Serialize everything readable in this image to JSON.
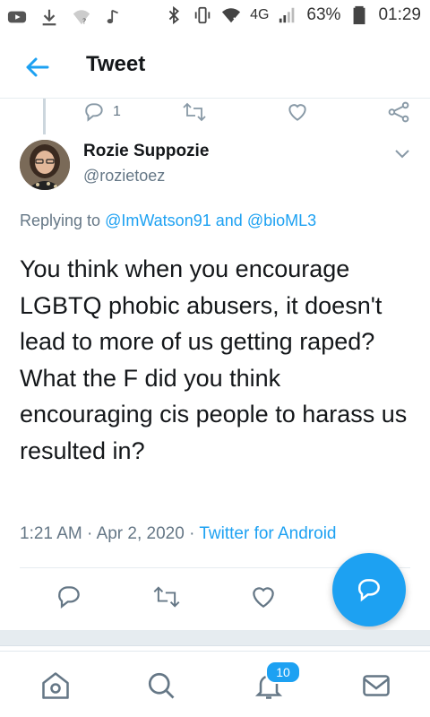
{
  "status_bar": {
    "network": "4G",
    "battery": "63%",
    "time": "01:29",
    "icons": [
      "youtube-icon",
      "download-icon",
      "wifi-question-icon",
      "music-note-icon",
      "bluetooth-icon",
      "vibrate-icon",
      "wifi-icon",
      "signal-icon",
      "battery-icon"
    ]
  },
  "app_bar": {
    "title": "Tweet",
    "back_icon": "arrow-left-icon"
  },
  "prev_tweet_actions": {
    "reply_count": "1"
  },
  "tweet": {
    "author_name": "Rozie Suppozie",
    "author_handle": "@rozietoez",
    "replying_prefix": "Replying to",
    "reply_to_1": "@ImWatson91",
    "reply_to_and": "and",
    "reply_to_2": "@bioML3",
    "text": "You think when you encourage LGBTQ phobic abusers, it doesn't lead to more of us getting raped? What the F did you think encouraging cis people to harass us resulted in?",
    "time": "1:21 AM",
    "date": "Apr 2, 2020",
    "separator": "·",
    "source": "Twitter for Android"
  },
  "bottom_nav": {
    "notifications_badge": "10"
  },
  "colors": {
    "accent": "#1da1f2",
    "muted": "#657786",
    "text": "#14171a",
    "divider": "#e6ecf0"
  }
}
